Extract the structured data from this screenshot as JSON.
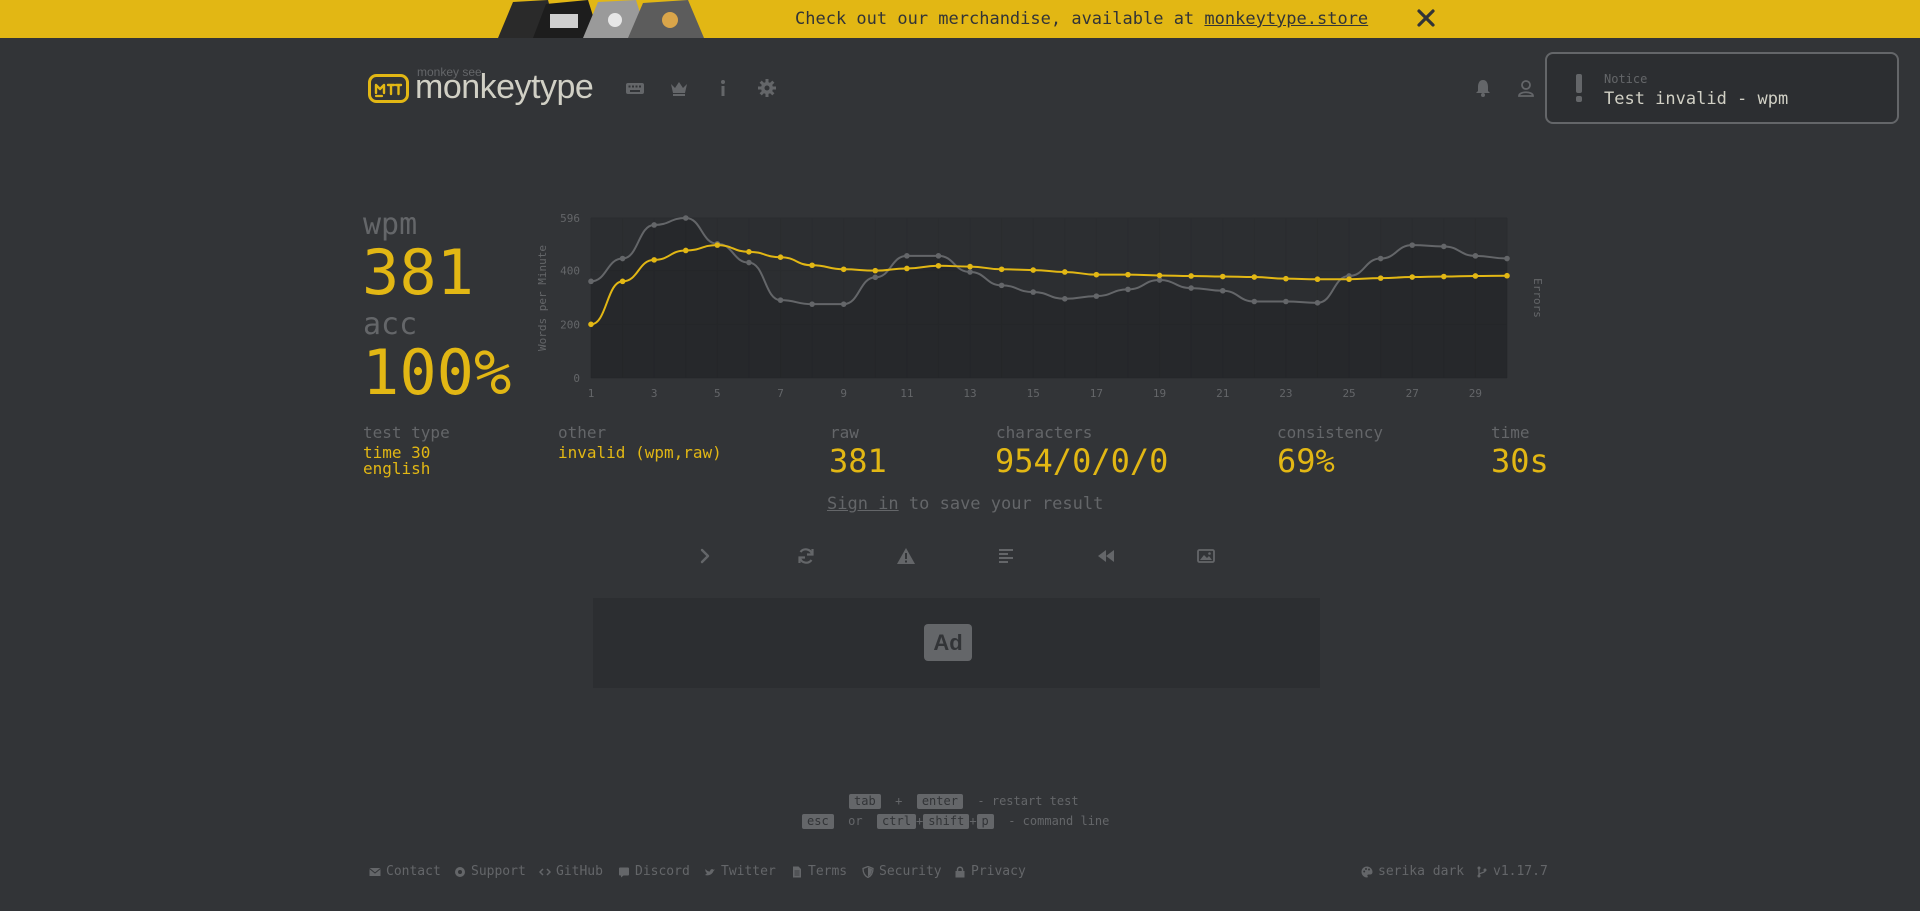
{
  "banner": {
    "text": "Check out our merchandise, available at ",
    "link": "monkeytype.store",
    "color": "#e2b714"
  },
  "header": {
    "logo_top": "monkey see",
    "logo_main": "monkeytype",
    "nav_icons": [
      "keyboard-icon",
      "crown-icon",
      "info-icon",
      "gear-icon"
    ],
    "right_icons": [
      "bell-icon",
      "user-icon"
    ]
  },
  "notice": {
    "title": "Notice",
    "message": "Test invalid - wpm"
  },
  "result": {
    "wpm_label": "wpm",
    "wpm": "381",
    "acc_label": "acc",
    "acc": "100%",
    "test_type_label": "test type",
    "test_type_line1": "time 30",
    "test_type_line2": "english",
    "other_label": "other",
    "other_value": "invalid (wpm,raw)",
    "raw_label": "raw",
    "raw": "381",
    "characters_label": "characters",
    "characters": "954/0/0/0",
    "consistency_label": "consistency",
    "consistency": "69%",
    "time_label": "time",
    "time": "30s"
  },
  "signin": {
    "link": "Sign in",
    "rest": " to save your result"
  },
  "actions": [
    "next-test-icon",
    "restart-icon",
    "warning-icon",
    "words-history-icon",
    "replay-icon",
    "screenshot-icon"
  ],
  "ad": {
    "label": "Ad"
  },
  "shortcuts": {
    "k1": "tab",
    "plus": "+",
    "k2": "enter",
    "restart": "- restart test",
    "k3": "esc",
    "or": "or",
    "k4": "ctrl",
    "k5": "shift",
    "k6": "p",
    "cmd": "- command line"
  },
  "footer": {
    "contact": "Contact",
    "support": "Support",
    "github": "GitHub",
    "discord": "Discord",
    "twitter": "Twitter",
    "terms": "Terms",
    "security": "Security",
    "privacy": "Privacy",
    "theme": "serika dark",
    "version": "v1.17.7"
  },
  "colors": {
    "background": "#323437",
    "main": "#e2b714",
    "sub": "#646669",
    "text": "#d1d0c5"
  },
  "chart_data": {
    "type": "line",
    "x": [
      1,
      2,
      3,
      4,
      5,
      6,
      7,
      8,
      9,
      10,
      11,
      12,
      13,
      14,
      15,
      16,
      17,
      18,
      19,
      20,
      21,
      22,
      23,
      24,
      25,
      26,
      27,
      28,
      29,
      30
    ],
    "x_tick_labels": [
      "1",
      "3",
      "5",
      "7",
      "9",
      "11",
      "13",
      "15",
      "17",
      "19",
      "21",
      "23",
      "25",
      "27",
      "29"
    ],
    "y_tick_labels": [
      "0",
      "200",
      "400",
      "596"
    ],
    "ylim": [
      0,
      596
    ],
    "ylabel": "Words per Minute",
    "y2label": "Errors",
    "grid": true,
    "series": [
      {
        "color": "#e2b714",
        "values": [
          200,
          360,
          440,
          475,
          495,
          470,
          450,
          420,
          405,
          400,
          408,
          418,
          415,
          405,
          402,
          395,
          385,
          385,
          382,
          380,
          378,
          376,
          370,
          368,
          368,
          372,
          376,
          378,
          380,
          381
        ]
      },
      {
        "color": "#646669",
        "values": [
          360,
          445,
          570,
          596,
          500,
          430,
          290,
          275,
          275,
          375,
          455,
          455,
          395,
          345,
          320,
          295,
          305,
          330,
          365,
          335,
          325,
          285,
          285,
          280,
          380,
          445,
          495,
          490,
          455,
          445
        ]
      }
    ]
  }
}
